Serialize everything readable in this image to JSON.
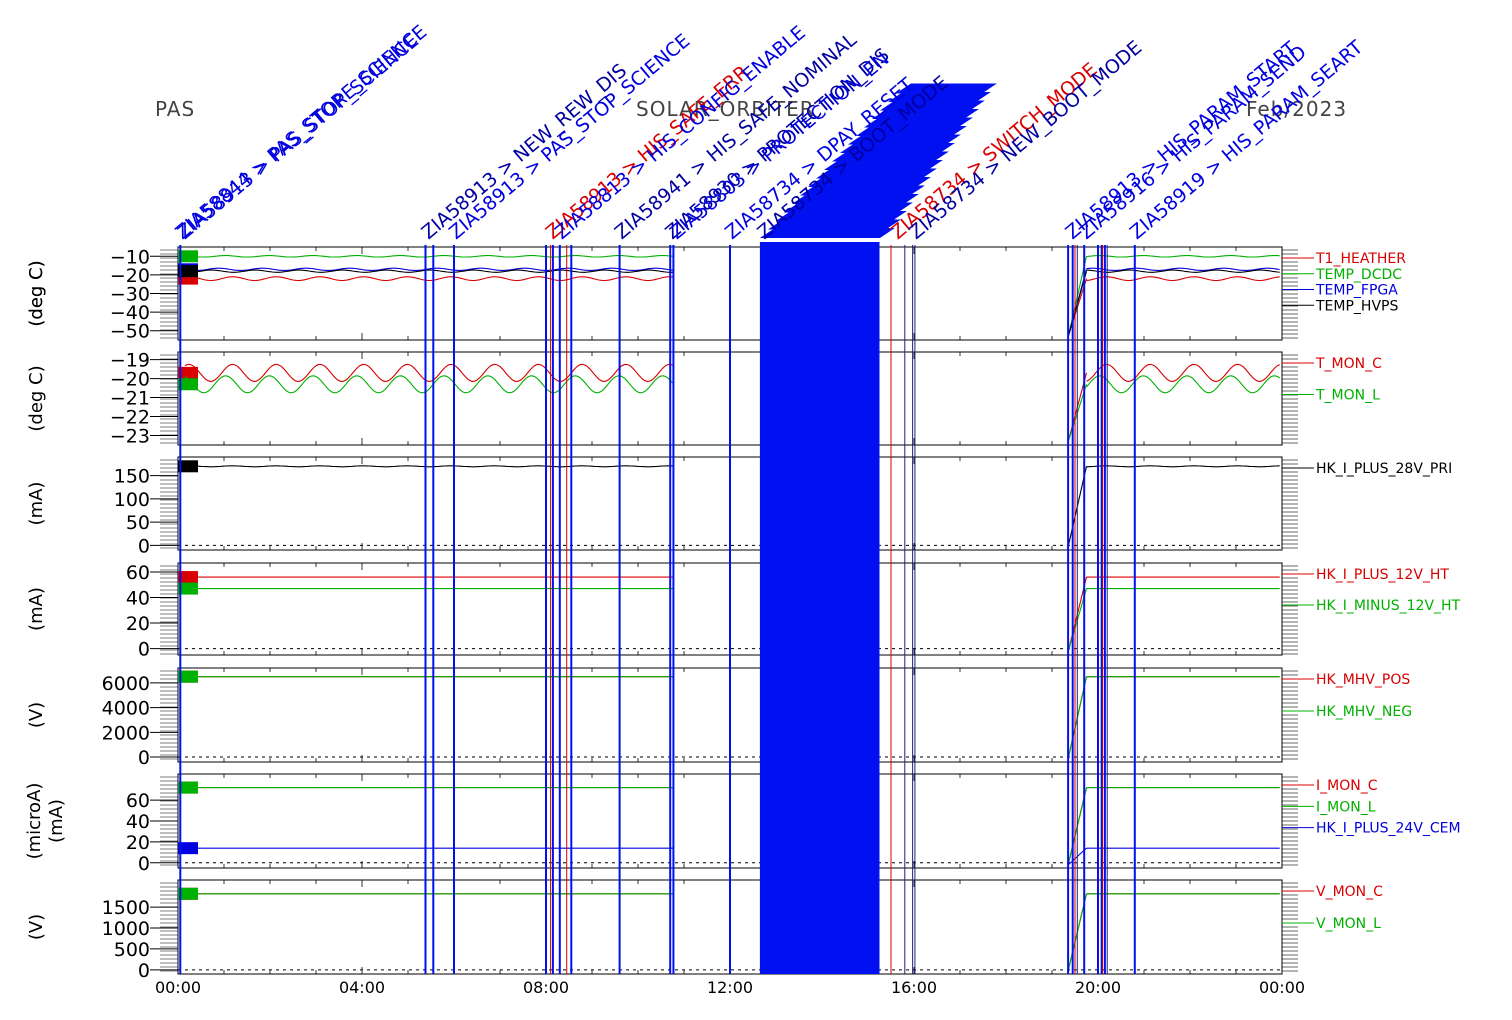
{
  "header": {
    "instrument": "PAS",
    "mission": "SOLAR_ORBITER",
    "date": "Feb/2023"
  },
  "colors": {
    "red": "#d80000",
    "green": "#00b000",
    "blue": "#0000e0",
    "black": "#000000",
    "event_blue": "#0010f0"
  },
  "events": {
    "lines_blue_hours": [
      0.05,
      5.38,
      5.55,
      6.0,
      8.0,
      8.15,
      8.3,
      8.55,
      9.6,
      10.7,
      10.77,
      12.0,
      19.35,
      19.45,
      19.7,
      20.0,
      20.08,
      20.15,
      20.8
    ],
    "lines_red_hours": [
      8.1,
      8.45,
      15.5,
      19.5,
      20.1
    ],
    "lines_navy_hours": [
      15.8,
      15.97,
      16.02,
      19.55,
      20.2
    ],
    "band_hours": [
      12.65,
      15.25
    ],
    "labels": [
      {
        "hour": 0.05,
        "text": "ZIA58844 > PAS_STORE_SCIENCE",
        "color": "#0000e0"
      },
      {
        "hour": 0.1,
        "text": "ZIA58913 > PAS_STOP_SCIENCE",
        "color": "#0000e0"
      },
      {
        "hour": 5.4,
        "text": "ZIA58913 > NEW_REW_DIS",
        "color": "#0000a0"
      },
      {
        "hour": 6.0,
        "text": "ZIA58913 > PAS_STOP_SCIENCE",
        "color": "#0000e0"
      },
      {
        "hour": 8.1,
        "text": "ZIA58913 > HIS_SAFE_ERR",
        "color": "#d80000"
      },
      {
        "hour": 8.3,
        "text": "ZIA58813 > HIS_CONFIG_ENABLE",
        "color": "#0000e0"
      },
      {
        "hour": 9.6,
        "text": "ZIA58941 > HIS_SAFE_NOMINAL",
        "color": "#0000a0"
      },
      {
        "hour": 10.7,
        "text": "ZIA58930 > PROTECTION_DIS",
        "color": "#0000a0"
      },
      {
        "hour": 10.8,
        "text": "ZIA58803 > PROTECTION_EN",
        "color": "#0000e0"
      },
      {
        "hour": 12.0,
        "text": "ZIA58734 > DPAY_RESET",
        "color": "#0000e0"
      },
      {
        "hour": 12.7,
        "text": "ZIA58734 > BOOT_MODE",
        "color": "#0000a0"
      },
      {
        "hour": 15.6,
        "text": "ZIA58734 > SWITCH_MODE",
        "color": "#d80000"
      },
      {
        "hour": 16.0,
        "text": "ZIA58734 > NEW_BOOT_MODE",
        "color": "#0000a0"
      },
      {
        "hour": 19.4,
        "text": "ZIA58913 > HIS_PARAM_START",
        "color": "#0000e0"
      },
      {
        "hour": 19.7,
        "text": "ZIA58916 > HIS_PARAM_SEND",
        "color": "#0000e0"
      },
      {
        "hour": 20.8,
        "text": "ZIA58919 > HIS_PARAM_SEART",
        "color": "#0000e0"
      }
    ]
  },
  "chart_data": [
    {
      "type": "line",
      "ylabel": "(deg C)",
      "ylim": [
        -55,
        -5
      ],
      "yticks": [
        -10,
        -20,
        -30,
        -40,
        -50
      ],
      "series": [
        {
          "name": "T1_HEATHER",
          "color": "#d80000",
          "level": -22,
          "amp": 1.0
        },
        {
          "name": "TEMP_DCDC",
          "color": "#00b000",
          "level": -10,
          "amp": 0.4
        },
        {
          "name": "TEMP_FPGA",
          "color": "#0000e0",
          "level": -17,
          "amp": 0.6
        },
        {
          "name": "TEMP_HVPS",
          "color": "#000000",
          "level": -18,
          "amp": 0.6
        }
      ]
    },
    {
      "type": "line",
      "ylabel": "(deg C)",
      "ylim": [
        -23.5,
        -18.6
      ],
      "yticks": [
        -19,
        -20,
        -21,
        -22,
        -23
      ],
      "series": [
        {
          "name": "T_MON_C",
          "color": "#d80000",
          "level": -19.7,
          "amp": 0.45
        },
        {
          "name": "T_MON_L",
          "color": "#00b000",
          "level": -20.3,
          "amp": 0.45
        }
      ]
    },
    {
      "type": "line",
      "ylabel": "(mA)",
      "ylim": [
        -10,
        190
      ],
      "yticks": [
        150,
        100,
        50,
        0
      ],
      "series": [
        {
          "name": "HK_I_PLUS_28V_PRI",
          "color": "#000000",
          "level": 170,
          "amp": 1
        }
      ]
    },
    {
      "type": "line",
      "ylabel": "(mA)",
      "ylim": [
        -5,
        67
      ],
      "yticks": [
        60,
        40,
        20,
        0
      ],
      "series": [
        {
          "name": "HK_I_PLUS_12V_HT",
          "color": "#d80000",
          "level": 56,
          "amp": 0
        },
        {
          "name": "HK_I_MINUS_12V_HT",
          "color": "#00b000",
          "level": 47,
          "amp": 0
        }
      ]
    },
    {
      "type": "line",
      "ylabel": "(V)",
      "ylim": [
        -400,
        7200
      ],
      "yticks": [
        6000,
        4000,
        2000,
        0
      ],
      "series": [
        {
          "name": "HK_MHV_POS",
          "color": "#d80000",
          "level": 6500,
          "amp": 0
        },
        {
          "name": "HK_MHV_NEG",
          "color": "#00b000",
          "level": 6500,
          "amp": 0
        }
      ]
    },
    {
      "type": "line",
      "ylabel": "(microA)",
      "ylabel2": "(mA)",
      "ylim": [
        -5,
        85
      ],
      "yticks": [
        60,
        40,
        20,
        0
      ],
      "series": [
        {
          "name": "I_MON_C",
          "color": "#d80000",
          "level": 72,
          "amp": 0
        },
        {
          "name": "I_MON_L",
          "color": "#00b000",
          "level": 72,
          "amp": 0
        },
        {
          "name": "HK_I_PLUS_24V_CEM",
          "color": "#0000e0",
          "level": 14,
          "amp": 0
        }
      ]
    },
    {
      "type": "line",
      "ylabel": "(V)",
      "ylim": [
        -100,
        2150
      ],
      "yticks": [
        1500,
        1000,
        500,
        0
      ],
      "series": [
        {
          "name": "V_MON_C",
          "color": "#d80000",
          "level": 1820,
          "amp": 0
        },
        {
          "name": "V_MON_L",
          "color": "#00b000",
          "level": 1820,
          "amp": 0
        }
      ]
    }
  ],
  "x_axis": {
    "xlim": [
      0,
      24
    ],
    "ticks": [
      0,
      4,
      8,
      12,
      16,
      20,
      24
    ],
    "tick_labels": [
      "00:00",
      "04:00",
      "08:00",
      "12:00",
      "16:00",
      "20:00",
      "00:00"
    ]
  }
}
